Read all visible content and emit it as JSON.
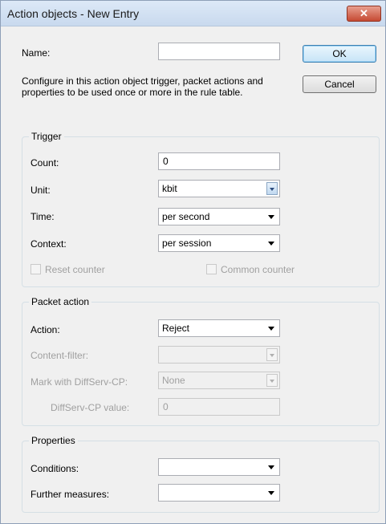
{
  "window": {
    "title": "Action objects - New Entry",
    "close_glyph": "✕"
  },
  "name_label": "Name:",
  "name_value": "",
  "ok_label": "OK",
  "cancel_label": "Cancel",
  "description": "Configure in this action object trigger, packet actions and properties to be used once or more in the rule table.",
  "trigger": {
    "title": "Trigger",
    "count_label": "Count:",
    "count_value": "0",
    "unit_label": "Unit:",
    "unit_value": "kbit",
    "time_label": "Time:",
    "time_value": "per second",
    "context_label": "Context:",
    "context_value": "per session",
    "reset_counter_label": "Reset counter",
    "common_counter_label": "Common counter"
  },
  "packet_action": {
    "title": "Packet action",
    "action_label": "Action:",
    "action_value": "Reject",
    "content_filter_label": "Content-filter:",
    "content_filter_value": "",
    "mark_label": "Mark with DiffServ-CP:",
    "mark_value": "None",
    "diffserv_value_label": "DiffServ-CP value:",
    "diffserv_value": "0"
  },
  "properties": {
    "title": "Properties",
    "conditions_label": "Conditions:",
    "conditions_value": "",
    "further_label": "Further measures:",
    "further_value": ""
  }
}
